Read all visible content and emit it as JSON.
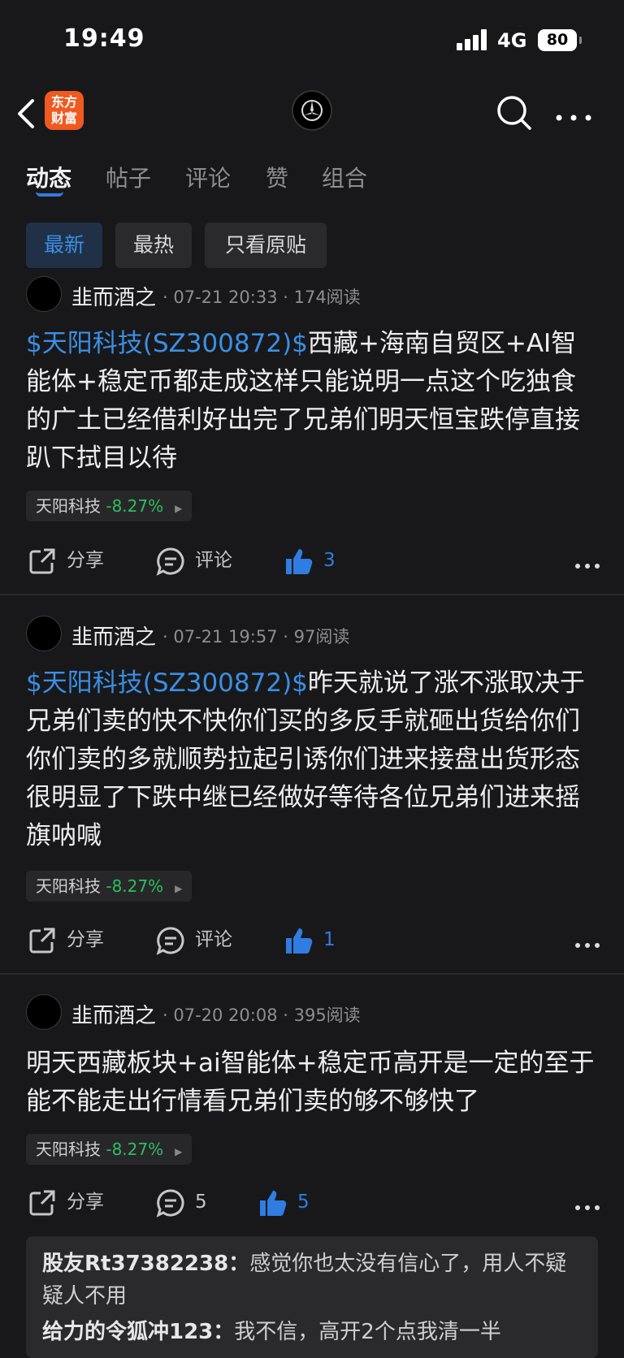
{
  "status_bar": {
    "time": "19:49",
    "network": "4G",
    "battery": "80"
  },
  "nav": {
    "logo_line1": "东方",
    "logo_line2": "财富"
  },
  "tabs": [
    {
      "label": "动态",
      "active": true
    },
    {
      "label": "帖子"
    },
    {
      "label": "评论"
    },
    {
      "label": "赞"
    },
    {
      "label": "组合"
    }
  ],
  "filters": [
    {
      "label": "最新",
      "active": true
    },
    {
      "label": "最热"
    },
    {
      "label": "只看原贴"
    }
  ],
  "posts": [
    {
      "username": "韭而酒之",
      "meta": "· 07-21 20:33 · 174阅读",
      "tag": "$天阳科技(SZ300872)$",
      "text": "西藏+海南自贸区+AI智能体+稳定币都走成这样只能说明一点这个吃独食的广土已经借利好出完了兄弟们明天恒宝跌停直接趴下拭目以待",
      "stock_name": "天阳科技",
      "stock_change": "-8.27%",
      "share_label": "分享",
      "comment_label": "评论",
      "like_count": "3"
    },
    {
      "username": "韭而酒之",
      "meta": "· 07-21 19:57 · 97阅读",
      "tag": "$天阳科技(SZ300872)$",
      "text": "昨天就说了涨不涨取决于兄弟们卖的快不快你们买的多反手就砸出货给你们你们卖的多就顺势拉起引诱你们进来接盘出货形态很明显了下跌中继已经做好等待各位兄弟们进来摇旗呐喊",
      "stock_name": "天阳科技",
      "stock_change": "-8.27%",
      "share_label": "分享",
      "comment_label": "评论",
      "like_count": "1"
    },
    {
      "username": "韭而酒之",
      "meta": "· 07-20 20:08 · 395阅读",
      "tag": "",
      "text": "明天西藏板块+ai智能体+稳定币高开是一定的至于能不能走出行情看兄弟们卖的够不够快了",
      "stock_name": "天阳科技",
      "stock_change": "-8.27%",
      "share_label": "分享",
      "comment_label": "5",
      "like_count": "5"
    }
  ],
  "comments": [
    {
      "name": "股友Rt37382238：",
      "text": "感觉你也太没有信心了，用人不疑疑人不用"
    },
    {
      "name": "给力的令狐冲123：",
      "text": "我不信，高开2个点我清一半"
    }
  ],
  "colors": {
    "accent": "#2f7de1",
    "up_green": "#2fbd5f",
    "bg": "#18181a"
  }
}
